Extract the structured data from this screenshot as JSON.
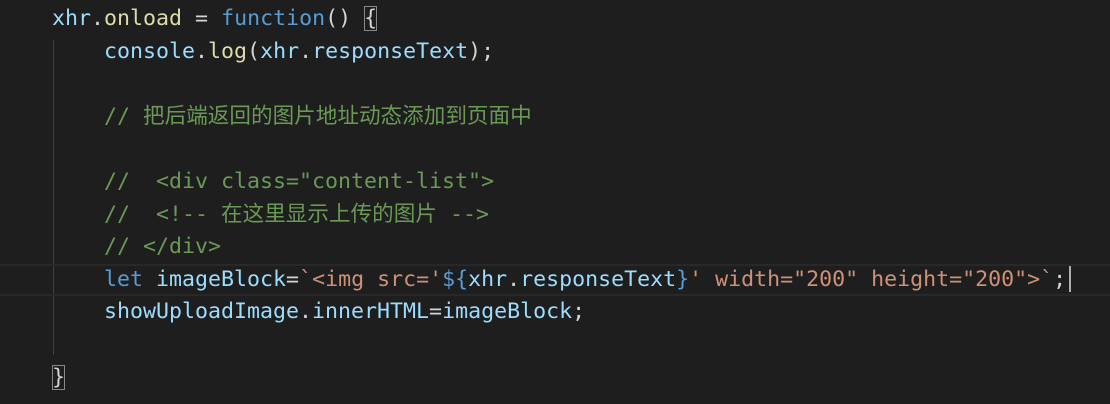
{
  "editor": {
    "lines": [
      {
        "tokens": [
          {
            "t": "xhr",
            "c": "var"
          },
          {
            "t": ".",
            "c": "pl"
          },
          {
            "t": "onload",
            "c": "fn"
          },
          {
            "t": " = ",
            "c": "pl"
          },
          {
            "t": "function",
            "c": "kw"
          },
          {
            "t": "() ",
            "c": "pl"
          },
          {
            "t": "{",
            "c": "brace"
          }
        ]
      },
      {
        "tokens": [
          {
            "t": "console",
            "c": "var"
          },
          {
            "t": ".",
            "c": "pl"
          },
          {
            "t": "log",
            "c": "fn"
          },
          {
            "t": "(",
            "c": "pl"
          },
          {
            "t": "xhr",
            "c": "var"
          },
          {
            "t": ".",
            "c": "pl"
          },
          {
            "t": "responseText",
            "c": "var"
          },
          {
            "t": ");",
            "c": "pl"
          }
        ]
      },
      {
        "tokens": []
      },
      {
        "tokens": [
          {
            "t": "// 把后端返回的图片地址动态添加到页面中",
            "c": "cm"
          }
        ]
      },
      {
        "tokens": []
      },
      {
        "tokens": [
          {
            "t": "//  <div class=\"content-list\">",
            "c": "cm"
          }
        ]
      },
      {
        "tokens": [
          {
            "t": "//  <!-- 在这里显示上传的图片 -->",
            "c": "cm"
          }
        ]
      },
      {
        "tokens": [
          {
            "t": "// </div>",
            "c": "cm"
          }
        ]
      },
      {
        "tokens": [
          {
            "t": "let",
            "c": "kw"
          },
          {
            "t": " ",
            "c": "pl"
          },
          {
            "t": "imageBlock",
            "c": "var"
          },
          {
            "t": "=",
            "c": "pl"
          },
          {
            "t": "`<img src='",
            "c": "str"
          },
          {
            "t": "${",
            "c": "kw"
          },
          {
            "t": "xhr",
            "c": "var"
          },
          {
            "t": ".",
            "c": "pl"
          },
          {
            "t": "responseText",
            "c": "var"
          },
          {
            "t": "}",
            "c": "kw"
          },
          {
            "t": "' width=\"200\" height=\"200\">`",
            "c": "str"
          },
          {
            "t": ";",
            "c": "pl"
          }
        ]
      },
      {
        "tokens": [
          {
            "t": "showUploadImage",
            "c": "var"
          },
          {
            "t": ".",
            "c": "pl"
          },
          {
            "t": "innerHTML",
            "c": "var"
          },
          {
            "t": "=",
            "c": "pl"
          },
          {
            "t": "imageBlock",
            "c": "var"
          },
          {
            "t": ";",
            "c": "pl"
          }
        ]
      },
      {
        "tokens": []
      },
      {
        "tokens": [
          {
            "t": "}",
            "c": "brace"
          }
        ]
      }
    ]
  },
  "colors": {
    "background": "#1e1e1e",
    "variable": "#9cdcfe",
    "function": "#dcdcaa",
    "keyword": "#569cd6",
    "string": "#ce9178",
    "comment": "#6a9955",
    "plain": "#d4d4d4"
  }
}
